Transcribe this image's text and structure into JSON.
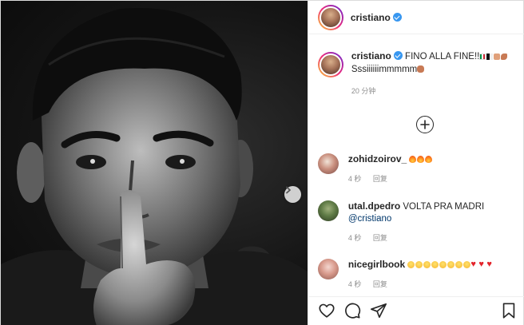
{
  "post": {
    "author": {
      "username": "cristiano",
      "verified": true,
      "avatar": "profile-photo"
    },
    "photo": {
      "description_icon": "black-and-white-portrait",
      "next_icon": "chevron-right-icon"
    },
    "caption": {
      "username": "cristiano",
      "text_line1": "FINO ALLA FINE!!",
      "text_line2": "Sssiiiiiimmmmm",
      "emojis_line1": [
        "flag-italy",
        "flag-black-white",
        "folded-hands",
        "flexed-biceps"
      ],
      "emojis_line2": [
        "oncoming-fist"
      ],
      "time": "20 分钟"
    },
    "load_more_icon": "plus-circle-icon",
    "comments": [
      {
        "username": "zohidzoirov_",
        "text": "",
        "emojis": [
          "fire",
          "fire",
          "fire"
        ],
        "time": "4 秒",
        "reply": "回复"
      },
      {
        "username": "utal.dpedro",
        "text": "VOLTA PRA MADRI",
        "mention": "@cristiano",
        "emojis": [],
        "time": "4 秒",
        "reply": "回复"
      },
      {
        "username": "nicegirlbook",
        "text": "",
        "emojis": [
          "grin",
          "grin",
          "grin",
          "grin",
          "grin",
          "grin",
          "grin",
          "grin",
          "heart",
          "heart",
          "heart"
        ],
        "time": "4 秒",
        "reply": "回复"
      }
    ],
    "actions": [
      "heart-icon",
      "comment-icon",
      "share-icon",
      "bookmark-icon"
    ],
    "colors": {
      "verified": "#3897f0",
      "mention": "#00376b",
      "meta": "#8e8e8e",
      "text": "#262626",
      "border": "#dbdbdb"
    }
  }
}
